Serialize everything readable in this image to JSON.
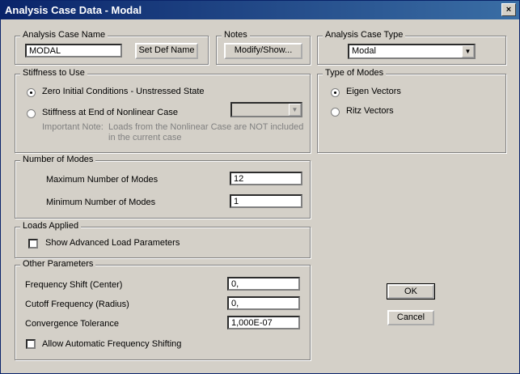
{
  "window": {
    "title": "Analysis Case Data - Modal",
    "close_glyph": "×"
  },
  "case_name": {
    "legend": "Analysis Case Name",
    "value": "MODAL",
    "set_def_label": "Set Def Name"
  },
  "notes": {
    "legend": "Notes",
    "button_label": "Modify/Show..."
  },
  "case_type": {
    "legend": "Analysis Case Type",
    "selected": "Modal"
  },
  "stiffness": {
    "legend": "Stiffness to Use",
    "option_zero": "Zero Initial Conditions - Unstressed State",
    "option_nonlinear": "Stiffness at End of Nonlinear Case",
    "note_label": "Important Note:",
    "note_line1": "Loads from the Nonlinear Case are NOT included",
    "note_line2": "in the current case",
    "selected": "zero"
  },
  "modes_type": {
    "legend": "Type of Modes",
    "option_eigen": "Eigen Vectors",
    "option_ritz": "Ritz Vectors",
    "selected": "eigen"
  },
  "num_modes": {
    "legend": "Number of Modes",
    "max_label": "Maximum Number of Modes",
    "max_value": "12",
    "min_label": "Minimum Number of Modes",
    "min_value": "1"
  },
  "loads": {
    "legend": "Loads Applied",
    "show_advanced_label": "Show Advanced Load Parameters",
    "show_advanced_checked": false
  },
  "other": {
    "legend": "Other Parameters",
    "freq_shift_label": "Frequency Shift (Center)",
    "freq_shift_value": "0,",
    "cutoff_label": "Cutoff Frequency (Radius)",
    "cutoff_value": "0,",
    "tolerance_label": "Convergence Tolerance",
    "tolerance_value": "1,000E-07",
    "auto_shift_label": "Allow Automatic Frequency Shifting",
    "auto_shift_checked": false
  },
  "actions": {
    "ok_label": "OK",
    "cancel_label": "Cancel"
  }
}
